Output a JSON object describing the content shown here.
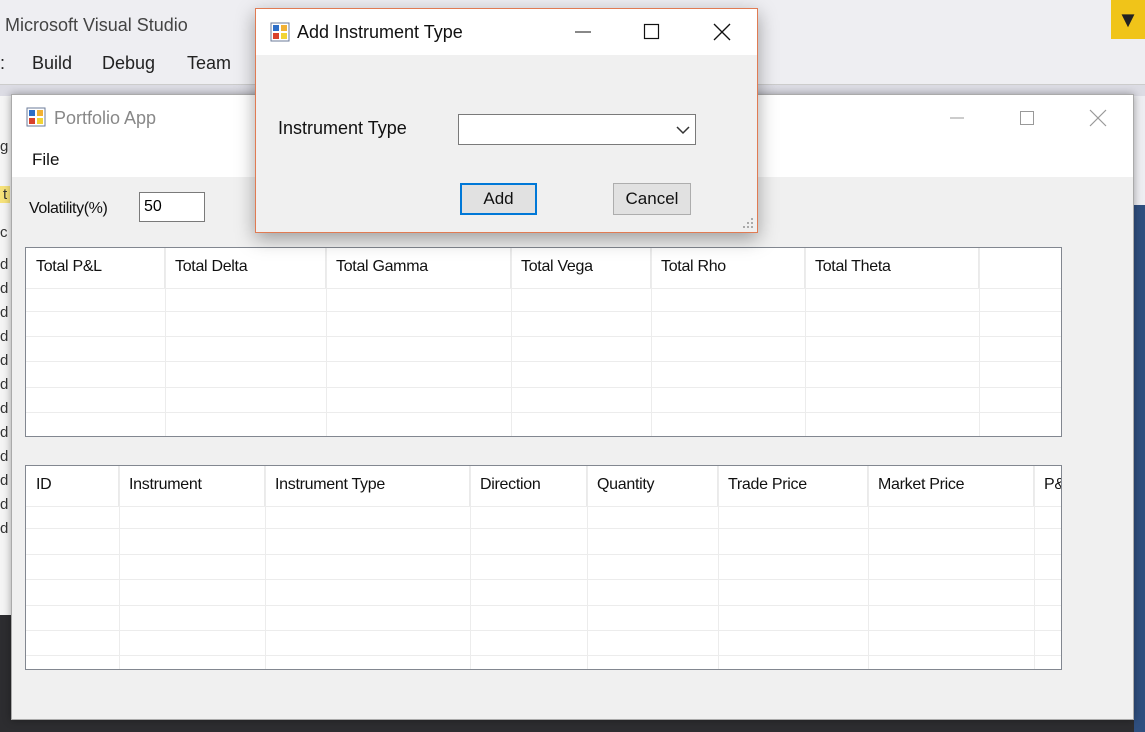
{
  "vs": {
    "title": "Microsoft Visual Studio",
    "menu": [
      "Build",
      "Debug",
      "Team"
    ],
    "notify_glyph": "▼",
    "left_strip": [
      "g",
      "t",
      "c",
      "d",
      "d",
      "d",
      "d",
      "d",
      "d",
      "d",
      "d",
      "d",
      "d",
      "d",
      "d"
    ]
  },
  "main_window": {
    "title": "Portfolio App",
    "menu_file": "File",
    "volatility_label": "Volatility(%)",
    "volatility_value": "50",
    "totals_headers": [
      "Total P&L",
      "Total Delta",
      "Total Gamma",
      "Total Vega",
      "Total Rho",
      "Total Theta"
    ],
    "trades_headers": [
      "ID",
      "Instrument",
      "Instrument Type",
      "Direction",
      "Quantity",
      "Trade Price",
      "Market Price",
      "P&"
    ]
  },
  "dialog": {
    "title": "Add Instrument Type",
    "label": "Instrument Type",
    "combo_value": "",
    "add_label": "Add",
    "cancel_label": "Cancel"
  },
  "icons": {
    "app": "app-icon",
    "minimize": "minimize-icon",
    "maximize": "maximize-icon",
    "close": "close-icon",
    "dropdown": "chevron-down-icon",
    "resize": "resize-grip-icon"
  },
  "colors": {
    "accent": "#0078d7",
    "dialog_border": "#e07b53",
    "vs_notify": "#f0c419"
  }
}
